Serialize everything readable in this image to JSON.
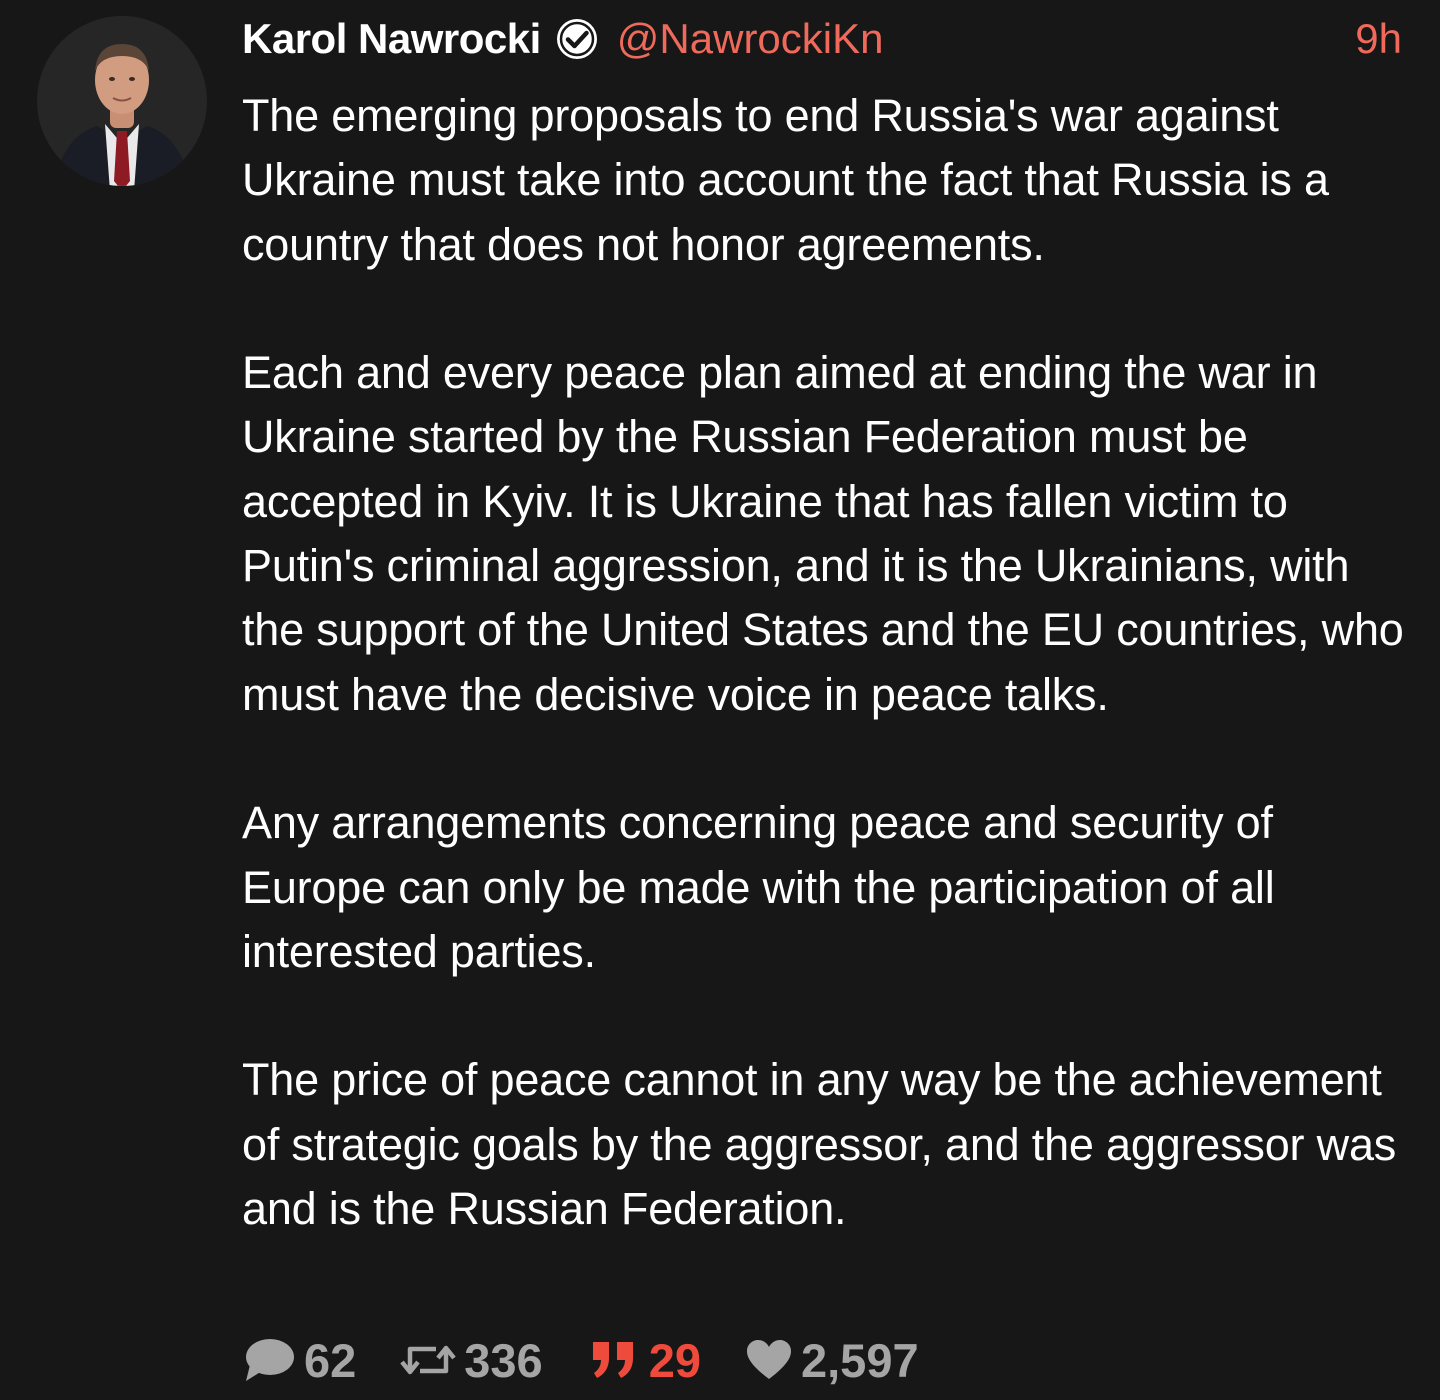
{
  "post": {
    "author_name": "Karol Nawrocki",
    "author_handle": "@NawrockiKn",
    "timestamp": "9h",
    "verified_icon": "verified-check-icon",
    "paragraphs": [
      "The emerging proposals to end Russia's war against Ukraine must take into account the fact that Russia is a country that does not honor agreements.",
      "Each and every peace plan aimed at ending the war in Ukraine started by the Russian Federation must be accepted in Kyiv. It is Ukraine that has fallen victim to Putin's criminal aggression, and it is the Ukrainians, with the support of the United States and the EU countries, who must have the decisive voice in peace talks.",
      "Any arrangements concerning peace and security of Europe can only be made with the participation of all interested parties.",
      "The price of peace cannot in any way be the achievement of strategic goals by the aggressor, and the aggressor was and is the Russian Federation."
    ]
  },
  "stats": {
    "replies": "62",
    "reposts": "336",
    "quotes": "29",
    "likes": "2,597"
  },
  "colors": {
    "background": "#171717",
    "accent": "#ef6a5a",
    "quote_accent": "#ef4b3d",
    "muted": "#a5a5a5",
    "text": "#ffffff"
  },
  "icons": {
    "reply": "comment-bubble-icon",
    "repost": "repost-arrows-icon",
    "quote": "quote-marks-icon",
    "like": "heart-icon"
  }
}
